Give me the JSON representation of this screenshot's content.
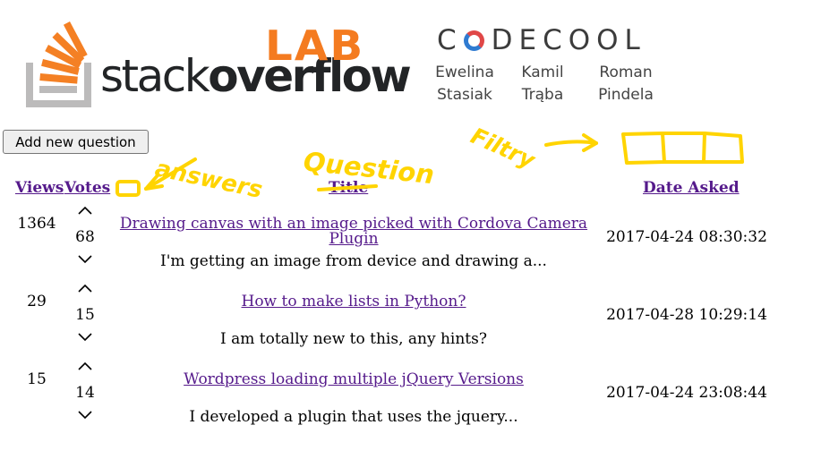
{
  "header": {
    "brand_plain": "stack",
    "brand_bold": "overflow",
    "lab": "LAB",
    "codecool_left": "C",
    "codecool_right": "DECOOL",
    "authors": [
      {
        "first": "Ewelina",
        "last": "Stasiak"
      },
      {
        "first": "Kamil",
        "last": "Trąba"
      },
      {
        "first": "Roman",
        "last": "Pindela"
      }
    ]
  },
  "toolbar": {
    "add_label": "Add new question"
  },
  "table": {
    "headers": {
      "views": "Views",
      "votes": "Votes",
      "title": "Title",
      "date": "Date Asked"
    },
    "rows": [
      {
        "views": "1364",
        "votes": "68",
        "title": "Drawing canvas with an image picked with Cordova Camera Plugin",
        "snippet": "I'm getting an image from device and drawing a...",
        "date": "2017-04-24 08:30:32"
      },
      {
        "views": "29",
        "votes": "15",
        "title": "How to make lists in Python?",
        "snippet": "I am totally new to this, any hints?",
        "date": "2017-04-28 10:29:14"
      },
      {
        "views": "15",
        "votes": "14",
        "title": "Wordpress loading multiple jQuery Versions",
        "snippet": "I developed a plugin that uses the jquery...",
        "date": "2017-04-24 23:08:44"
      }
    ]
  },
  "annotations": {
    "answers": "answers",
    "question": "Question",
    "filter": "Filtry",
    "color": "#ffd400"
  },
  "colors": {
    "link": "#551a8b",
    "lab_orange": "#f47b20",
    "so_orange": "#f48024"
  }
}
